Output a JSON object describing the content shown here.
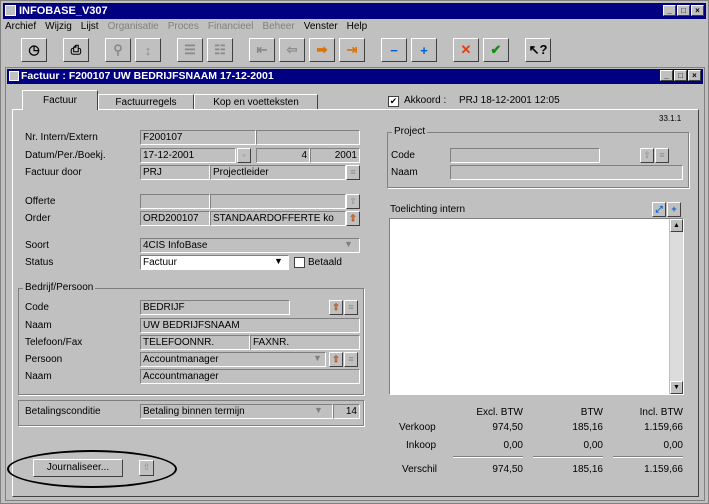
{
  "app": {
    "title": "INFOBASE_V307"
  },
  "menu": [
    "Archief",
    "Wijzig",
    "Lijst",
    "Organisatie",
    "Proces",
    "Financieel",
    "Beheer",
    "Venster",
    "Help"
  ],
  "menu_disabled": [
    false,
    false,
    false,
    true,
    true,
    true,
    true,
    false,
    false
  ],
  "toolbar": {
    "icons": [
      "clock-icon",
      "print-icon",
      "find-icon",
      "sort-icon",
      "list-icon",
      "grid-icon",
      "first-icon",
      "prev-icon",
      "next-icon",
      "last-icon",
      "minus-icon",
      "plus-icon",
      "cancel-icon",
      "confirm-icon",
      "help-icon"
    ]
  },
  "window": {
    "title": "Factuur : F200107 UW BEDRIJFSNAAM  17-12-2001"
  },
  "tabs": [
    "Factuur",
    "Factuurregels",
    "Kop en voetteksten"
  ],
  "akkoord": {
    "label": "Akkoord :",
    "value": "PRJ 18-12-2001 12:05",
    "checked": true
  },
  "version": "33.1.1",
  "form": {
    "nr_label": "Nr. Intern/Extern",
    "nr_value": "F200107",
    "nr_extern": "",
    "datum_label": "Datum/Per./Boekj.",
    "datum_value": "17-12-2001",
    "per_value": "4",
    "boekj_value": "2001",
    "factuur_door_label": "Factuur door",
    "factuur_door_code": "PRJ",
    "factuur_door_naam": "Projectleider",
    "offerte_label": "Offerte",
    "offerte_value": "",
    "offerte_desc": "",
    "order_label": "Order",
    "order_value": "ORD200107",
    "order_desc": "STANDAARDOFFERTE ko",
    "soort_label": "Soort",
    "soort_value": "4CIS InfoBase",
    "status_label": "Status",
    "status_value": "Factuur",
    "betaald_label": "Betaald",
    "betaald_checked": false
  },
  "bedrijf": {
    "group_label": "Bedrijf/Persoon",
    "code_label": "Code",
    "code_value": "BEDRIJF",
    "naam_label": "Naam",
    "naam_value": "UW BEDRIJFSNAAM",
    "tel_label": "Telefoon/Fax",
    "tel_value": "TELEFOONNR.",
    "fax_value": "FAXNR.",
    "persoon_label": "Persoon",
    "persoon_value": "Accountmanager",
    "naam2_label": "Naam",
    "naam2_value": "Accountmanager"
  },
  "betaling": {
    "label": "Betalingsconditie",
    "value": "Betaling binnen termijn",
    "days": "14"
  },
  "project": {
    "group_label": "Project",
    "code_label": "Code",
    "code_value": "",
    "naam_label": "Naam",
    "naam_value": ""
  },
  "toelichting": {
    "label": "Toelichting intern",
    "value": ""
  },
  "totals": {
    "headers": [
      "Excl. BTW",
      "BTW",
      "Incl. BTW"
    ],
    "rows": [
      {
        "label": "Verkoop",
        "excl": "974,50",
        "btw": "185,16",
        "incl": "1.159,66"
      },
      {
        "label": "Inkoop",
        "excl": "0,00",
        "btw": "0,00",
        "incl": "0,00"
      },
      {
        "label": "Verschil",
        "excl": "974,50",
        "btw": "185,16",
        "incl": "1.159,66"
      }
    ]
  },
  "journaliseer": {
    "label": "Journaliseer..."
  }
}
